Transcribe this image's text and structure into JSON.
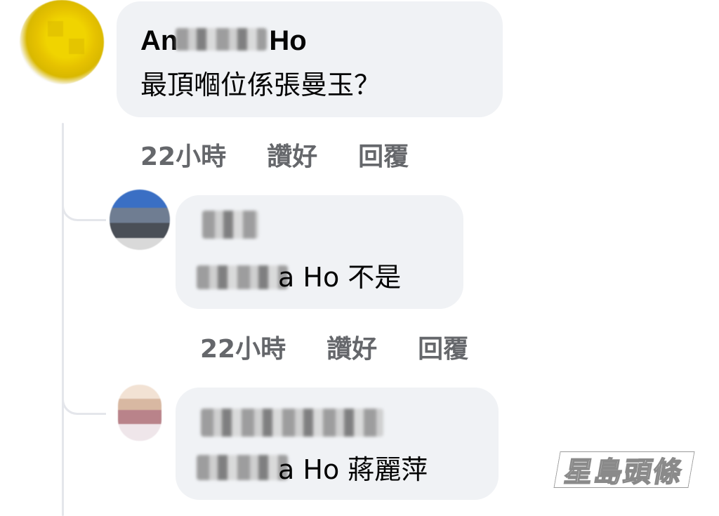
{
  "comment": {
    "author_visible": "Ho",
    "author_visible_left": "An",
    "message": "最頂嗰位係張曼玉？",
    "actions": {
      "time": "22小時",
      "like": "讚好",
      "reply": "回覆"
    }
  },
  "replies": [
    {
      "message_suffix": "a Ho 不是",
      "actions": {
        "time": "22小時",
        "like": "讚好",
        "reply": "回覆"
      }
    },
    {
      "message_suffix": "a Ho 蔣麗萍"
    }
  ],
  "watermark": {
    "text": "星島頭條"
  }
}
